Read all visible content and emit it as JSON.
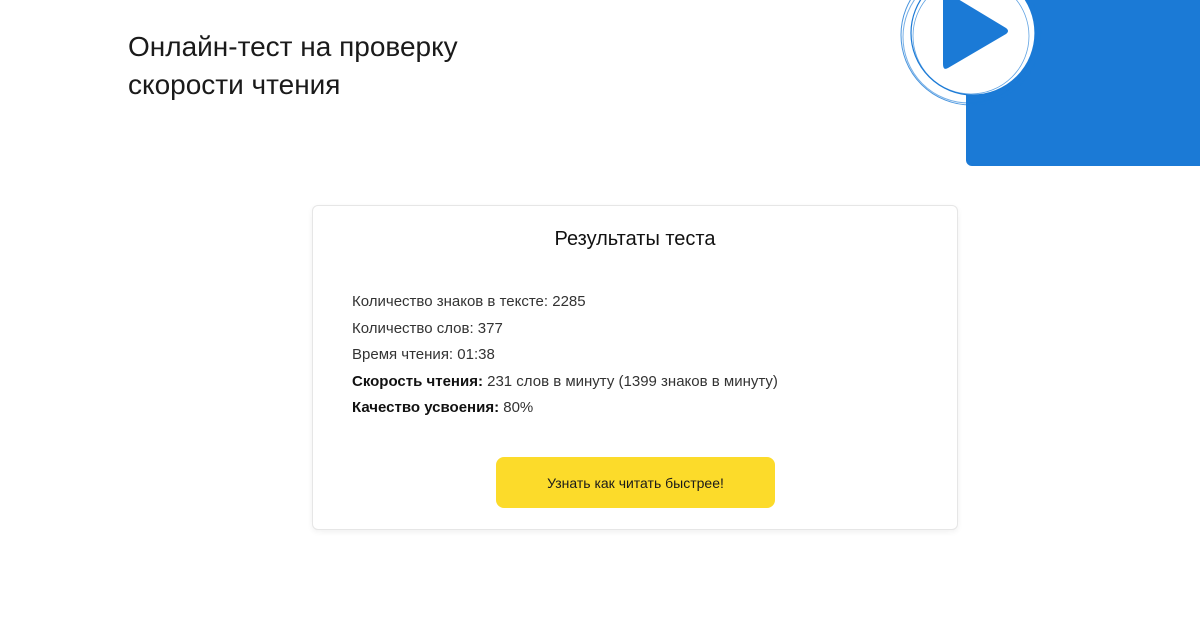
{
  "header": {
    "title_line1": "Онлайн-тест на проверку",
    "title_line2": "скорости чтения"
  },
  "brand": {
    "icon": "play-icon",
    "accent_color": "#1b7ad6"
  },
  "results": {
    "title": "Результаты теста",
    "chars_text": "Количество знаков в тексте: 2285",
    "words_text": "Количество слов: 377",
    "time_text": "Время чтения: 01:38",
    "speed_label": "Скорость чтения:",
    "speed_value": " 231 слов в минуту (1399 знаков в минуту)",
    "quality_label": "Качество усвоения:",
    "quality_value": " 80%",
    "cta_label": "Узнать как читать быстрее!",
    "cta_color": "#fcdb2a"
  }
}
